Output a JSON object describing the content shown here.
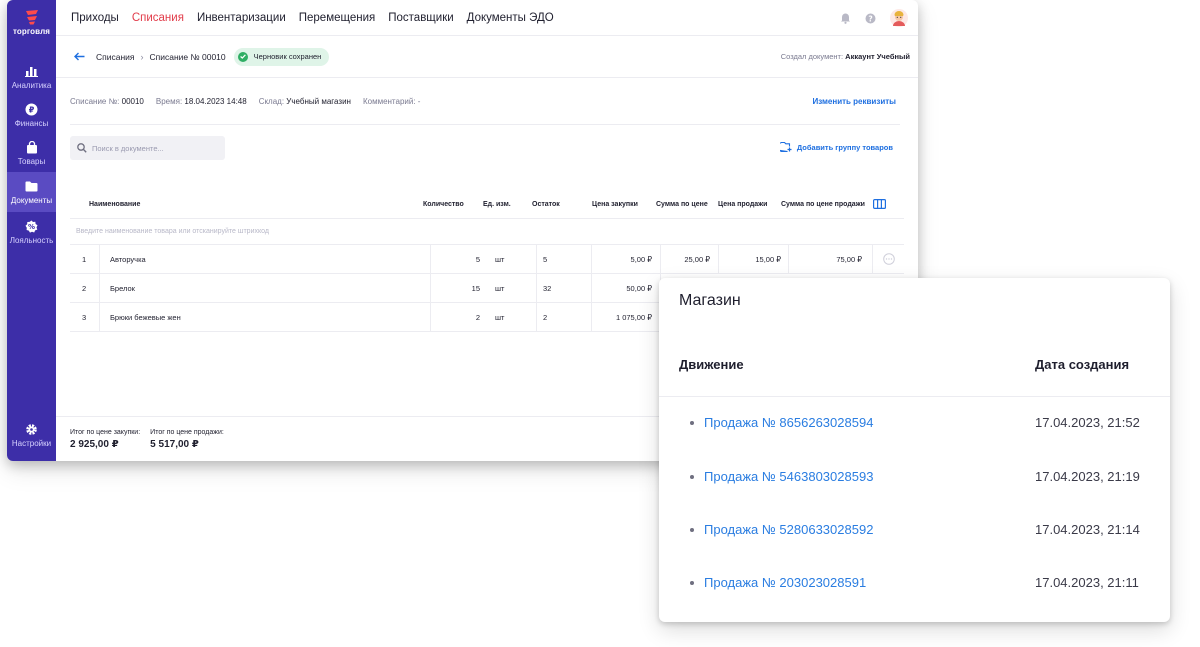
{
  "sidebar": {
    "logo_text": "торговля",
    "items": [
      {
        "label": "Аналитика",
        "icon": "bar-chart-icon"
      },
      {
        "label": "Финансы",
        "icon": "ruble-icon"
      },
      {
        "label": "Товары",
        "icon": "bag-icon"
      },
      {
        "label": "Документы",
        "icon": "folder-icon",
        "active": true
      },
      {
        "label": "Лояльность",
        "icon": "percent-badge-icon"
      }
    ],
    "settings_label": "Настройки"
  },
  "topnav": {
    "tabs": [
      "Приходы",
      "Списания",
      "Инвентаризации",
      "Перемещения",
      "Поставщики",
      "Документы ЭДО"
    ],
    "active_tab": "Списания"
  },
  "breadcrumb": {
    "parent": "Списания",
    "current": "Списание № 00010",
    "badge": "Черновик сохранен",
    "creator_label": "Создал документ:",
    "creator_name": "Аккаунт Учебный"
  },
  "requisites": {
    "number_label": "Списание №:",
    "number": "00010",
    "time_label": "Время:",
    "time": "18.04.2023 14:48",
    "warehouse_label": "Склад:",
    "warehouse": "Учебный магазин",
    "comment_label": "Комментарий:",
    "comment": "-",
    "edit_link": "Изменить реквизиты"
  },
  "toolbar": {
    "search_placeholder": "Поиск в документе...",
    "add_group": "Добавить группу товаров"
  },
  "table": {
    "columns": [
      "Наименование",
      "Количество",
      "Ед. изм.",
      "Остаток",
      "Цена закупки",
      "Сумма по цене",
      "Цена продажи",
      "Сумма по цене продажи"
    ],
    "input_placeholder": "Введите наименование товара или отсканируйте штрихкод",
    "rows": [
      {
        "n": "1",
        "name": "Авторучка",
        "qty": "5",
        "unit": "шт",
        "rest": "5",
        "buy_price": "5,00 ₽",
        "buy_sum": "25,00 ₽",
        "sell_price": "15,00 ₽",
        "sell_sum": "75,00 ₽"
      },
      {
        "n": "2",
        "name": "Брелок",
        "qty": "15",
        "unit": "шт",
        "rest": "32",
        "buy_price": "50,00 ₽",
        "buy_sum": "",
        "sell_price": "",
        "sell_sum": ""
      },
      {
        "n": "3",
        "name": "Брюки бежевые жен",
        "qty": "2",
        "unit": "шт",
        "rest": "2",
        "buy_price": "1 075,00 ₽",
        "buy_sum": "",
        "sell_price": "",
        "sell_sum": ""
      }
    ]
  },
  "totals": {
    "buy_label": "Итог по цене закупки:",
    "buy_value": "2 925,00 ₽",
    "sell_label": "Итог по цене продажи:",
    "sell_value": "5 517,00 ₽"
  },
  "popup": {
    "title": "Магазин",
    "col_movement": "Движение",
    "col_date": "Дата создания",
    "rows": [
      {
        "link": "Продажа № 8656263028594",
        "date": "17.04.2023, 21:52"
      },
      {
        "link": "Продажа № 5463803028593",
        "date": "17.04.2023, 21:19"
      },
      {
        "link": "Продажа № 5280633028592",
        "date": "17.04.2023, 21:14"
      },
      {
        "link": "Продажа № 203023028591",
        "date": "17.04.2023, 21:11"
      }
    ]
  },
  "colors": {
    "sidebar": "#3d2ea8",
    "accent_red": "#e23d4b",
    "link_blue": "#1e6fe0",
    "badge_green": "#2fae64"
  }
}
